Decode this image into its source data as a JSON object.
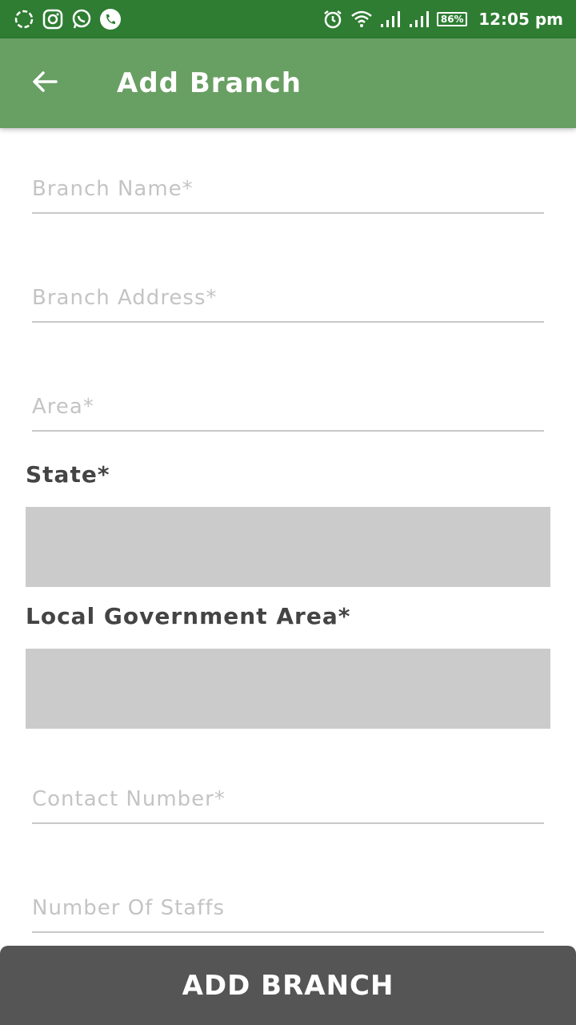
{
  "status_bar": {
    "icons_left": [
      "sync-icon",
      "instagram-icon",
      "whatsapp-icon",
      "phone-icon"
    ],
    "icons_right": [
      "alarm-icon",
      "wifi-icon",
      "signal-icon",
      "signal-icon"
    ],
    "battery": "86%",
    "time": "12:05 pm",
    "color": "#2e7d32"
  },
  "app_bar": {
    "title": "Add Branch",
    "color": "#689f63"
  },
  "form": {
    "branch_name_placeholder": "Branch Name*",
    "branch_address_placeholder": "Branch Address*",
    "area_placeholder": "Area*",
    "state_label": "State*",
    "lga_label": "Local Government Area*",
    "contact_number_placeholder": "Contact Number*",
    "number_of_staffs_placeholder": "Number Of Staffs"
  },
  "footer": {
    "add_branch_label": "ADD BRANCH",
    "color": "#555555"
  }
}
